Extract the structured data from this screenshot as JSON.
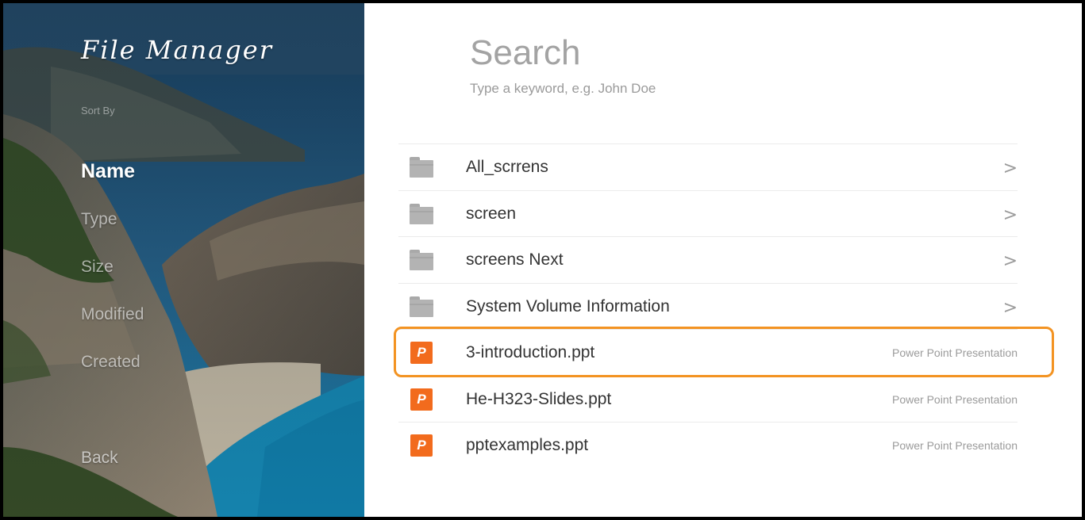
{
  "app": {
    "title": "File Manager"
  },
  "sidebar": {
    "sort_label": "Sort By",
    "items": [
      {
        "label": "Name",
        "active": true
      },
      {
        "label": "Type",
        "active": false
      },
      {
        "label": "Size",
        "active": false
      },
      {
        "label": "Modified",
        "active": false
      },
      {
        "label": "Created",
        "active": false
      }
    ],
    "back_label": "Back"
  },
  "search": {
    "title": "Search",
    "placeholder": "Type a keyword, e.g. John Doe"
  },
  "files": [
    {
      "name": "All_scrrens",
      "kind": "folder",
      "icon": "folder-icon",
      "chevron": ">"
    },
    {
      "name": "screen",
      "kind": "folder",
      "icon": "folder-icon",
      "chevron": ">"
    },
    {
      "name": "screens Next",
      "kind": "folder",
      "icon": "folder-icon",
      "chevron": ">"
    },
    {
      "name": "System Volume Information",
      "kind": "folder",
      "icon": "folder-icon",
      "chevron": ">"
    },
    {
      "name": "3-introduction.ppt",
      "kind": "ppt",
      "icon": "ppt-icon",
      "icon_letter": "P",
      "type_label": "Power Point Presentation",
      "selected": true
    },
    {
      "name": "He-H323-Slides.ppt",
      "kind": "ppt",
      "icon": "ppt-icon",
      "icon_letter": "P",
      "type_label": "Power Point Presentation"
    },
    {
      "name": "pptexamples.ppt",
      "kind": "ppt",
      "icon": "ppt-icon",
      "icon_letter": "P",
      "type_label": "Power Point Presentation"
    }
  ],
  "colors": {
    "ppt_icon": "#f26b1d",
    "folder_icon": "#b3b3b3",
    "selection_outline": "#f39322"
  }
}
